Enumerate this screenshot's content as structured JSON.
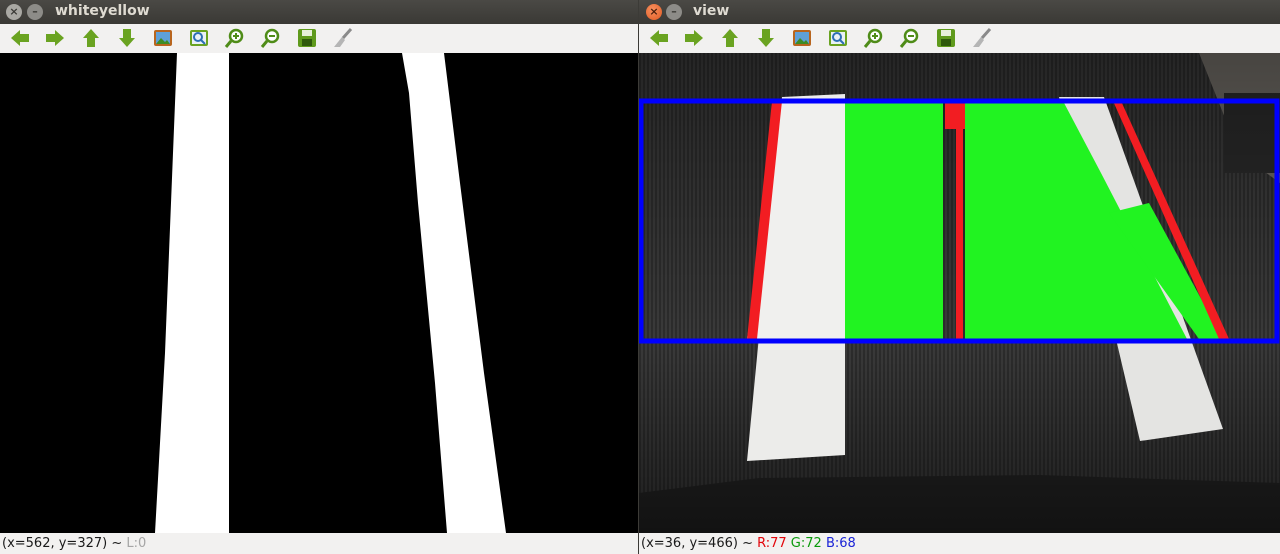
{
  "windows": [
    {
      "title": "whiteyellow",
      "status": {
        "coords": "(x=562, y=327) ~ ",
        "extra": "L:0"
      }
    },
    {
      "title": "view",
      "status": {
        "coords": "(x=36, y=466) ~ ",
        "r": "R:77",
        "g": "G:72",
        "b": "B:68"
      }
    }
  ],
  "toolbar_icons": [
    "arrow-left-icon",
    "arrow-right-icon",
    "arrow-up-icon",
    "arrow-down-icon",
    "image-icon",
    "zoom-fit-icon",
    "zoom-in-icon",
    "zoom-out-icon",
    "save-icon",
    "brush-icon"
  ],
  "colors": {
    "icon_green": "#6aa321",
    "lane_green": "#21f321",
    "lane_red": "#f21d22",
    "roi_blue": "#0000ff",
    "close_orange": "#e8612b"
  }
}
